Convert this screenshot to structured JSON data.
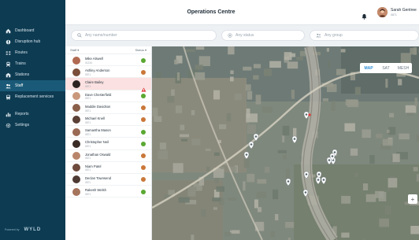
{
  "header": {
    "title": "Operations Centre",
    "user_name": "Sarah Gentree",
    "user_role": "0871"
  },
  "sidebar": {
    "items": [
      {
        "label": "Dashboard",
        "icon": "home-icon"
      },
      {
        "label": "Disruption hub",
        "icon": "disruption-icon"
      },
      {
        "label": "Routes",
        "icon": "routes-icon"
      },
      {
        "label": "Trains",
        "icon": "train-icon"
      },
      {
        "label": "Stations",
        "icon": "station-icon"
      },
      {
        "label": "Staff",
        "icon": "staff-icon",
        "active": true
      },
      {
        "label": "Replacement services",
        "icon": "bus-icon"
      },
      {
        "label": "Reports",
        "icon": "reports-icon"
      },
      {
        "label": "Settings",
        "icon": "gear-icon"
      }
    ],
    "footer_powered": "Powered by",
    "footer_brand": "WYLD"
  },
  "filters": {
    "search_placeholder": "Any name/number",
    "status_placeholder": "Any status",
    "group_placeholder": "Any group"
  },
  "list": {
    "header_staff": "Staff",
    "header_status": "Status",
    "rows": [
      {
        "name": "Mike Alswell",
        "id": "01234",
        "status": "ok"
      },
      {
        "name": "Ashley Anderson",
        "id": "0871",
        "status": "busy"
      },
      {
        "name": "Claire Bailey",
        "id": "0871",
        "status": "alert"
      },
      {
        "name": "Dave Chesterfield",
        "id": "0871",
        "status": "ok"
      },
      {
        "name": "Maddie Davidson",
        "id": "0871",
        "status": "busy"
      },
      {
        "name": "Michael Knell",
        "id": "0871",
        "status": "busy"
      },
      {
        "name": "Samantha Mason",
        "id": "0871",
        "status": "ok"
      },
      {
        "name": "Christopher Neil",
        "id": "0871",
        "status": "ok"
      },
      {
        "name": "Jonathan Oswald",
        "id": "0871",
        "status": "busy"
      },
      {
        "name": "Niam Patel",
        "id": "0871",
        "status": "busy"
      },
      {
        "name": "Declan Townsend",
        "id": "0871",
        "status": "busy"
      },
      {
        "name": "Rakesh Welsh",
        "id": "0871",
        "status": "ok"
      }
    ]
  },
  "map": {
    "modes": [
      "MAP",
      "SAT",
      "MESH"
    ],
    "active_mode": "MAP",
    "zoom_in": "+"
  },
  "colors": {
    "sidebar": "#0d3b52",
    "ok": "#5aa832",
    "busy": "#c9783a",
    "alert": "#e23b3b",
    "accent": "#2d8ed6"
  }
}
